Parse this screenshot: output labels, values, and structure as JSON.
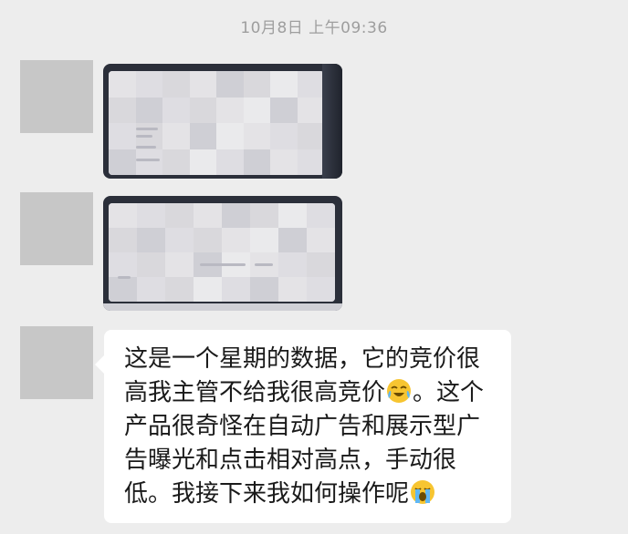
{
  "timestamp": "10月8日 上午09:36",
  "messages": [
    {
      "type": "image",
      "alt": ""
    },
    {
      "type": "image",
      "alt": ""
    },
    {
      "type": "text",
      "line1": "这是一个星期的数据，它的竞价很",
      "line2a": "高我主管不给我很高竞价",
      "emoji1": "laughing-crying-emoji",
      "line2b": "。这个",
      "line3": "产品很奇怪在自动广告和展示型广",
      "line4": "告曝光和点击相对高点，手动很",
      "line5a": "低。我接下来我如何操作呢",
      "emoji2": "loudly-crying-emoji"
    }
  ],
  "colors": {
    "background": "#ededed",
    "bubble": "#ffffff",
    "avatar": "#c7c7c7",
    "timestamp_text": "#9e9e9e"
  }
}
